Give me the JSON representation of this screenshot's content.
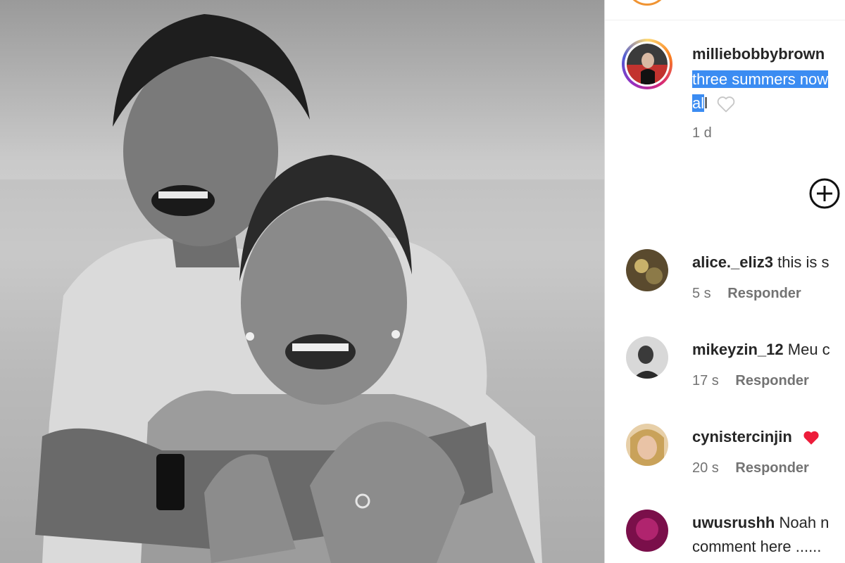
{
  "post": {
    "owner_username": "milliebobbybrown",
    "caption_highlighted_line1": "three summers now",
    "caption_highlighted_line2": "al",
    "caption_rest": "l",
    "time_ago": "1 d"
  },
  "comments": [
    {
      "username": "alice._eliz3",
      "text": "this is s",
      "time": "5 s",
      "reply_label": "Responder"
    },
    {
      "username": "mikeyzin_12",
      "text": "Meu c",
      "time": "17 s",
      "reply_label": "Responder"
    },
    {
      "username": "cynistercinjin",
      "text": "",
      "time": "20 s",
      "reply_label": "Responder",
      "emoji": "red-heart"
    },
    {
      "username": "uwusrushh",
      "text": "Noah n",
      "text_line2": "comment here ......",
      "time": "",
      "reply_label": ""
    }
  ],
  "icons": {
    "like": "heart-outline-icon",
    "add": "plus-circle-icon",
    "emoji_heart": "red-heart-icon"
  },
  "colors": {
    "highlight": "#3b8cf2",
    "muted": "#737373",
    "text": "#262626",
    "heart_red": "#ed1c3a"
  }
}
